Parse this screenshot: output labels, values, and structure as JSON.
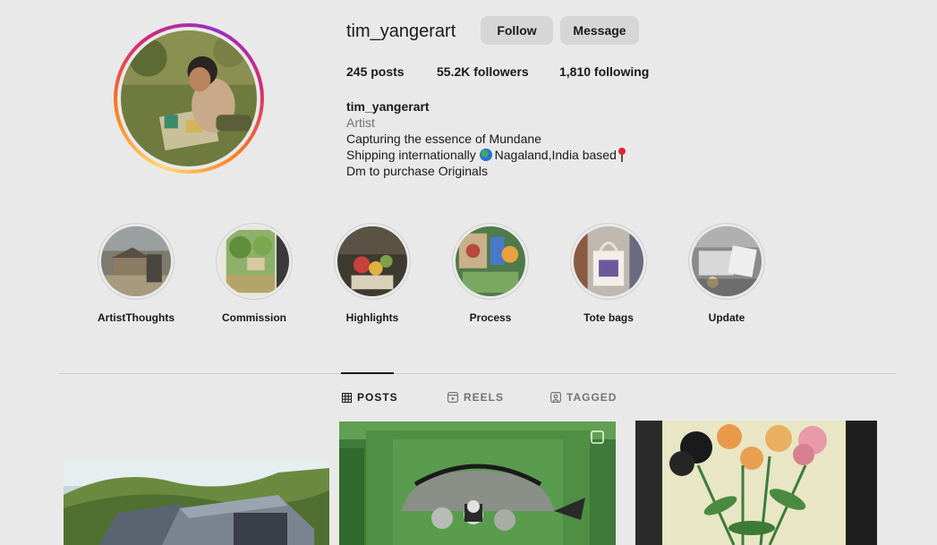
{
  "profile": {
    "username": "tim_yangerart",
    "follow_label": "Follow",
    "message_label": "Message",
    "stats": {
      "posts": "245 posts",
      "followers": "55.2K followers",
      "following": "1,810 following"
    },
    "bio": {
      "name": "tim_yangerart",
      "category": "Artist",
      "line1": "Capturing the essence of Mundane",
      "line2_pre": "Shipping internationally ",
      "line2_post": "Nagaland,India based",
      "line3": "Dm to purchase Originals"
    }
  },
  "highlights": [
    {
      "label": "ArtistThoughts"
    },
    {
      "label": "Commission"
    },
    {
      "label": "Highlights"
    },
    {
      "label": "Process"
    },
    {
      "label": "Tote bags"
    },
    {
      "label": "Update"
    }
  ],
  "tabs": {
    "posts": "POSTS",
    "reels": "REELS",
    "tagged": "TAGGED"
  },
  "icons": {
    "globe": "globe-icon",
    "pin": "round-pushpin-icon",
    "grid": "grid-icon",
    "reels": "reels-icon",
    "tagged": "tagged-icon",
    "multi": "multiple-photos-icon"
  },
  "colors": {
    "background": "#e9e9e9",
    "button": "#d6d6d6",
    "muted_text": "#737373"
  }
}
